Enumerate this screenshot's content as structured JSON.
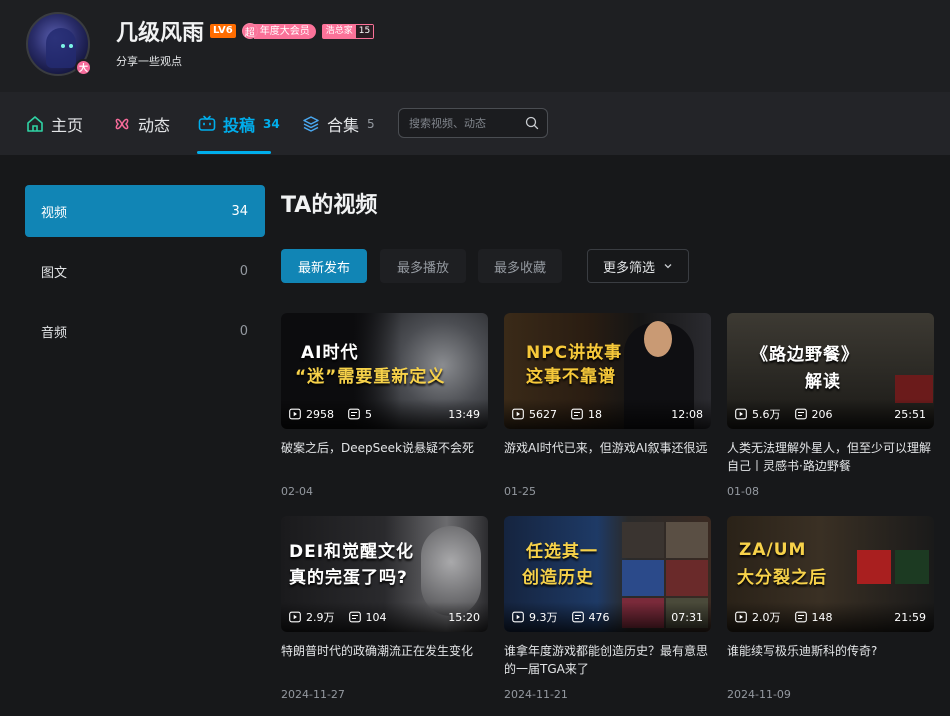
{
  "header": {
    "username": "几级风雨",
    "level_badge": "LV6",
    "avatar_badge": "大",
    "vip_icon": "超",
    "vip_label": "年度大会员",
    "fan_medal_name": "浩总家",
    "fan_medal_level": "15",
    "sign": "分享一些观点"
  },
  "nav": {
    "home": "主页",
    "dynamic": "动态",
    "upload": "投稿",
    "upload_count": "34",
    "collection": "合集",
    "collection_count": "5",
    "search_placeholder": "搜索视频、动态"
  },
  "sidebar": {
    "items": [
      {
        "label": "视频",
        "count": "34"
      },
      {
        "label": "图文",
        "count": "0"
      },
      {
        "label": "音频",
        "count": "0"
      }
    ]
  },
  "main": {
    "title": "TA的视频",
    "filters": [
      "最新发布",
      "最多播放",
      "最多收藏"
    ],
    "more_filter": "更多筛选"
  },
  "videos": [
    {
      "thumb_title_1": "AI时代",
      "thumb_title_2": "“迷”需要重新定义",
      "plays": "2958",
      "danmaku": "5",
      "duration": "13:49",
      "title": "破案之后，DeepSeek说悬疑不会死",
      "date": "02-04"
    },
    {
      "thumb_title_1": "NPC讲故事",
      "thumb_title_2": "这事不靠谱",
      "plays": "5627",
      "danmaku": "18",
      "duration": "12:08",
      "title": "游戏AI时代已来，但游戏AI叙事还很远",
      "date": "01-25"
    },
    {
      "thumb_title_1": "《路边野餐》",
      "thumb_title_2": "解读",
      "plays": "5.6万",
      "danmaku": "206",
      "duration": "25:51",
      "title": "人类无法理解外星人，但至少可以理解自己丨灵感书·路边野餐",
      "date": "01-08"
    },
    {
      "thumb_title_1": "DEI和觉醒文化",
      "thumb_title_2": "真的完蛋了吗?",
      "plays": "2.9万",
      "danmaku": "104",
      "duration": "15:20",
      "title": "特朗普时代的政确潮流正在发生变化",
      "date": "2024-11-27"
    },
    {
      "thumb_title_1": "任选其一",
      "thumb_title_2": "创造历史",
      "plays": "9.3万",
      "danmaku": "476",
      "duration": "07:31",
      "title": "谁拿年度游戏都能创造历史？最有意思的一届TGA来了",
      "date": "2024-11-21"
    },
    {
      "thumb_title_1": "ZA/UM",
      "thumb_title_2": "大分裂之后",
      "plays": "2.0万",
      "danmaku": "148",
      "duration": "21:59",
      "title": "谁能续写极乐迪斯科的传奇?",
      "date": "2024-11-09"
    }
  ],
  "colors": {
    "accent": "#00aeec",
    "vip_pink": "#fb7299",
    "level_orange": "#ff6c00"
  }
}
